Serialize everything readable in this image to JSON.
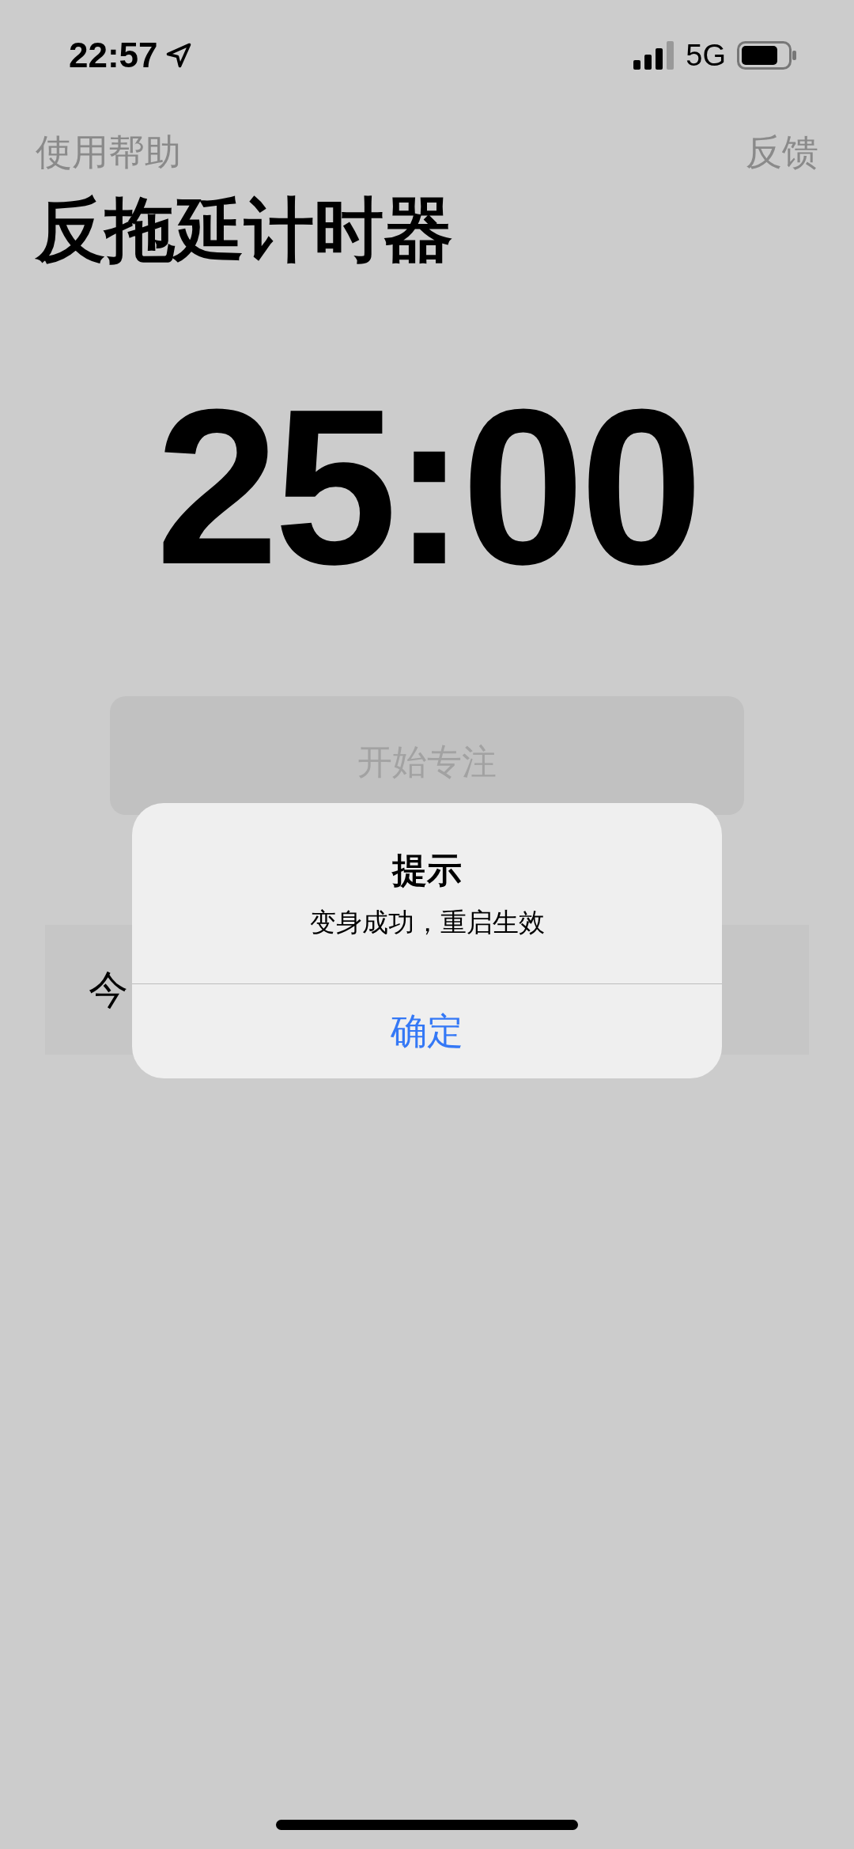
{
  "status_bar": {
    "time": "22:57",
    "network": "5G"
  },
  "nav": {
    "left": "使用帮助",
    "right": "反馈"
  },
  "title": "反拖延计时器",
  "timer": "25:00",
  "start_button": {
    "label": "开始专注"
  },
  "today_row": {
    "label": "今"
  },
  "alert": {
    "title": "提示",
    "message": "变身成功，重启生效",
    "buttons": [
      "确定"
    ]
  }
}
